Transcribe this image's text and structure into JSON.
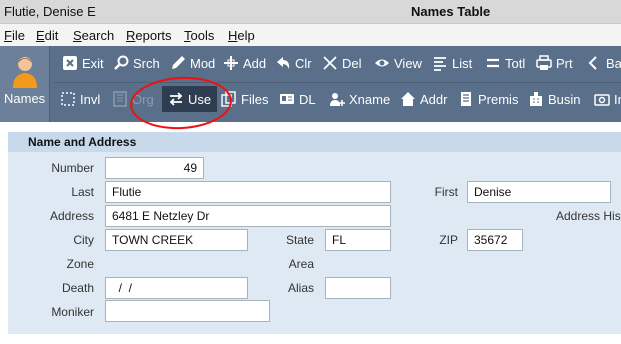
{
  "window": {
    "title": "Flutie, Denise E",
    "center_title": "Names Table"
  },
  "menu": {
    "items": [
      "File",
      "Edit",
      "Search",
      "Reports",
      "Tools",
      "Help"
    ],
    "underline": [
      "F",
      "E",
      "S",
      "R",
      "T",
      "H"
    ]
  },
  "module": {
    "label": "Names"
  },
  "toolbar_row1": [
    {
      "label": "Exit",
      "icon": "exit-icon"
    },
    {
      "label": "Srch",
      "icon": "search-icon"
    },
    {
      "label": "Mod",
      "icon": "pencil-icon"
    },
    {
      "label": "Add",
      "icon": "plus-icon"
    },
    {
      "label": "Clr",
      "icon": "undo-icon"
    },
    {
      "label": "Del",
      "icon": "x-icon"
    },
    {
      "label": "View",
      "icon": "eye-icon"
    },
    {
      "label": "List",
      "icon": "list-icon"
    },
    {
      "label": "Totl",
      "icon": "equals-icon"
    },
    {
      "label": "Prt",
      "icon": "printer-icon"
    },
    {
      "label": "Ba",
      "icon": "back-arrow-icon"
    }
  ],
  "toolbar_row2": [
    {
      "label": "Invl",
      "icon": "dashed-box-icon"
    },
    {
      "label": "Org",
      "icon": "building-disabled-icon",
      "disabled": true
    },
    {
      "label": "Use",
      "icon": "swap-arrows-icon",
      "active": true
    },
    {
      "label": "Files",
      "icon": "files-icon"
    },
    {
      "label": "DL",
      "icon": "id-card-icon"
    },
    {
      "label": "Xname",
      "icon": "person-plus-icon"
    },
    {
      "label": "Addr",
      "icon": "house-icon"
    },
    {
      "label": "Premis",
      "icon": "building-icon"
    },
    {
      "label": "Busin",
      "icon": "business-icon"
    },
    {
      "label": "In",
      "icon": "camera-icon"
    }
  ],
  "panel": {
    "title": "Name and Address"
  },
  "form": {
    "number_label": "Number",
    "number_value": "49",
    "last_label": "Last",
    "last_value": "Flutie",
    "first_label": "First",
    "first_value": "Denise",
    "address_label": "Address",
    "address_value": "6481 E Netzley Dr",
    "address_history_label": "Address His",
    "city_label": "City",
    "city_value": "TOWN CREEK",
    "state_label": "State",
    "state_value": "FL",
    "zip_label": "ZIP",
    "zip_value": "35672",
    "zone_label": "Zone",
    "area_label": "Area",
    "death_label": "Death",
    "death_value": "  /  /",
    "alias_label": "Alias",
    "alias_value": "",
    "moniker_label": "Moniker",
    "moniker_value": ""
  },
  "colors": {
    "toolbar": "#5a6f89",
    "panel": "#dfe9f4",
    "annotation": "#e11111"
  }
}
